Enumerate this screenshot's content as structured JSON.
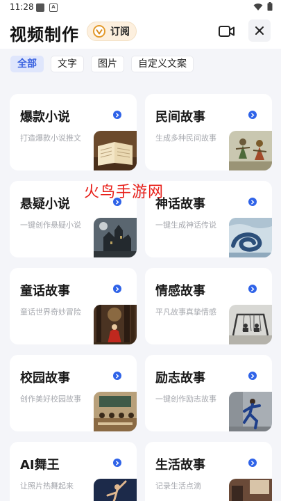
{
  "status": {
    "time": "11:28",
    "small_icon_letter": "A"
  },
  "header": {
    "title": "视频制作",
    "subscribe_label": "订阅"
  },
  "tabs": [
    {
      "label": "全部",
      "active": true
    },
    {
      "label": "文字",
      "active": false
    },
    {
      "label": "图片",
      "active": false
    },
    {
      "label": "自定义文案",
      "active": false
    }
  ],
  "cards": [
    {
      "title": "爆款小说",
      "subtitle": "打造爆款小说推文",
      "image": "open-book-image"
    },
    {
      "title": "民间故事",
      "subtitle": "生成多种民间故事",
      "image": "folk-dancers-image"
    },
    {
      "title": "悬疑小说",
      "subtitle": "一键创作悬疑小说",
      "image": "haunted-house-image"
    },
    {
      "title": "神话故事",
      "subtitle": "一键生成神话传说",
      "image": "sea-serpent-image"
    },
    {
      "title": "童话故事",
      "subtitle": "童话世界奇妙冒险",
      "image": "forest-girl-image"
    },
    {
      "title": "情感故事",
      "subtitle": "平凡故事真挚情感",
      "image": "swing-couple-image"
    },
    {
      "title": "校园故事",
      "subtitle": "创作美好校园故事",
      "image": "classroom-image"
    },
    {
      "title": "励志故事",
      "subtitle": "一键创作励志故事",
      "image": "runner-image"
    },
    {
      "title": "AI舞王",
      "subtitle": "让照片热舞起来",
      "image": "dancer-image"
    },
    {
      "title": "生活故事",
      "subtitle": "记录生活点滴",
      "image": "room-image"
    }
  ],
  "watermark": "火鸟手游网",
  "colors": {
    "accent": "#2f63e8",
    "tab_active_bg": "#dfe6fc",
    "subscribe_bg": "#fdf0df",
    "watermark": "#e8201a"
  }
}
